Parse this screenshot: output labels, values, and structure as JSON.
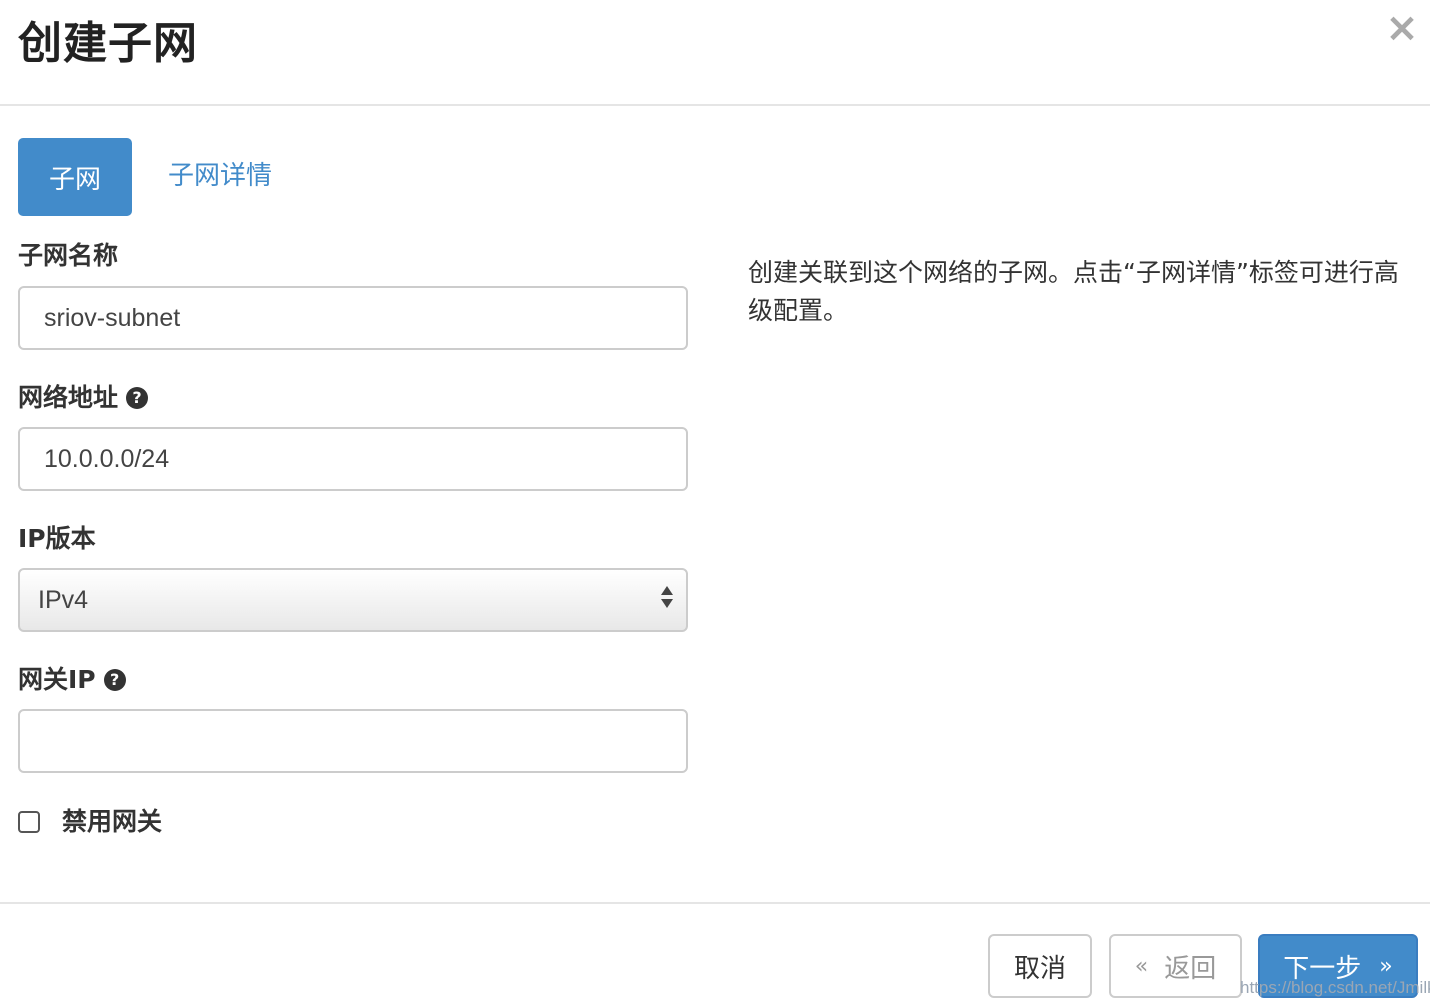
{
  "dialog": {
    "title": "创建子网",
    "close_icon": "×"
  },
  "tabs": [
    {
      "label": "子网",
      "active": true
    },
    {
      "label": "子网详情",
      "active": false
    }
  ],
  "form": {
    "subnet_name": {
      "label": "子网名称",
      "value": "sriov-subnet"
    },
    "network_address": {
      "label": "网络地址",
      "help_icon": "?",
      "value": "10.0.0.0/24"
    },
    "ip_version": {
      "label": "IP版本",
      "selected": "IPv4"
    },
    "gateway_ip": {
      "label": "网关IP",
      "help_icon": "?",
      "value": ""
    },
    "disable_gateway": {
      "label": "禁用网关",
      "checked": false
    }
  },
  "description": "创建关联到这个网络的子网。点击“子网详情”标签可进行高级配置。",
  "footer": {
    "cancel_label": "取消",
    "back_label": "返回",
    "back_chevron": "«",
    "next_label": "下一步",
    "next_chevron": "»"
  },
  "watermark": "https://blog.csdn.net/Jmilk",
  "colors": {
    "primary": "#428bca",
    "border": "#cccccc"
  }
}
